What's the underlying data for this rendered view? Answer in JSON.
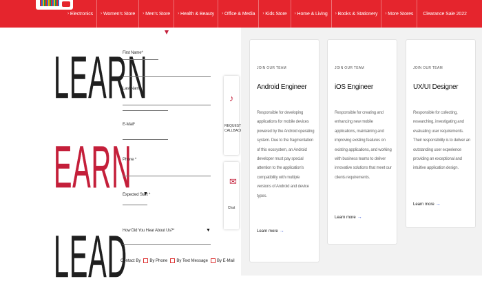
{
  "nav": {
    "items": [
      {
        "label": "Electronics"
      },
      {
        "label": "Women's Store"
      },
      {
        "label": "Men's Store"
      },
      {
        "label": "Health & Beauty"
      },
      {
        "label": "Office & Media"
      },
      {
        "label": "Kids Store"
      },
      {
        "label": "Home & Living"
      },
      {
        "label": "Books & Stationery"
      },
      {
        "label": "More Stores"
      }
    ],
    "clearance": "Clearance Sale 2022",
    "chevron": "›"
  },
  "hero": {
    "word1": "LEARN",
    "word2": "EARN",
    "word3": "LEAD"
  },
  "form": {
    "first_name": "First Name*",
    "last_name": "Last Name *",
    "email": "E-Mail*",
    "phone": "Phone *",
    "expected": "Expected Start *",
    "how_heard": "How Did You Hear About Us?*",
    "contact_by": "Contact By",
    "opt_phone": "By Phone",
    "opt_text": "By Text Message",
    "opt_email": "By E-Mail",
    "arrow": "▼"
  },
  "side": {
    "top_icon": "♪",
    "top_text": "REQUEST CALLBACK",
    "bottom_icon": "✉",
    "bottom_text": "Chat"
  },
  "jobs": [
    {
      "kicker": "JOIN OUR TEAM",
      "title": "Android Engineer",
      "desc": "Responsible for developing applications for mobile devices powered by the Android operating system. Due to the fragmentation of this ecosystem, an Android developer must pay special attention to the application's compatibility with multiple versions of Android and device types.",
      "link": "Learn more"
    },
    {
      "kicker": "JOIN OUR TEAM",
      "title": "iOS Engineer",
      "desc": "Responsible for creating and enhancing new mobile applications, maintaining and improving existing features on existing applications, and working with business teams to deliver innovative solutions that meet our clients requirements.",
      "link": "Learn more"
    },
    {
      "kicker": "JOIN OUR TEAM",
      "title": "UX/UI Designer",
      "desc": "Responsible for collecting, researching, investigating and evaluating user requirements. Their responsibility is to deliver an outstanding user experience providing an exceptional and intuitive application design.",
      "link": "Learn more"
    }
  ],
  "link_arrow": "→"
}
